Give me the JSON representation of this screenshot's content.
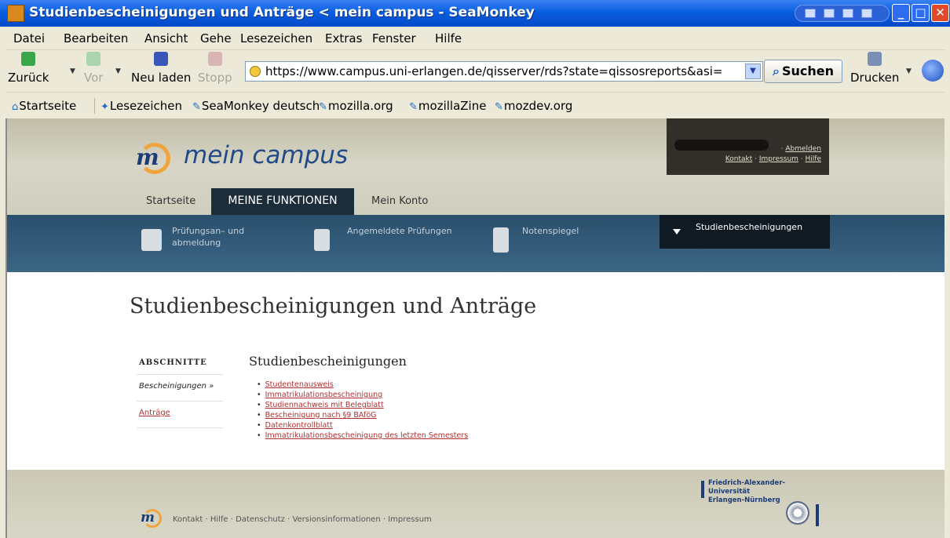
{
  "window": {
    "title": "Studienbescheinigungen und Anträge < mein campus - SeaMonkey"
  },
  "menu": [
    "Datei",
    "Bearbeiten",
    "Ansicht",
    "Gehe",
    "Lesezeichen",
    "Extras",
    "Fenster",
    "Hilfe"
  ],
  "toolbar": {
    "back": "Zurück",
    "forward": "Vor",
    "reload": "Neu laden",
    "stop": "Stopp",
    "url": "https://www.campus.uni-erlangen.de/qisserver/rds?state=qissosreports&asi=",
    "search": "Suchen",
    "print": "Drucken"
  },
  "bookmarks": [
    "Startseite",
    "Lesezeichen",
    "SeaMonkey deutsch",
    "mozilla.org",
    "mozillaZine",
    "mozdev.org"
  ],
  "site": {
    "logo_letter": "m",
    "logo_text": "mein campus",
    "user": {
      "logout": "Abmelden",
      "contact": "Kontakt",
      "imprint": "Impressum",
      "help": "Hilfe"
    },
    "nav": {
      "home": "Startseite",
      "functions": "MEINE FUNKTIONEN",
      "account": "Mein Konto"
    },
    "subnav": {
      "exams_line1": "Prüfungsan– und",
      "exams_line2": "abmeldung",
      "registered": "Angemeldete Prüfungen",
      "grades": "Notenspiegel",
      "certificates": "Studienbescheinigungen"
    },
    "page_title": "Studienbescheinigungen und Anträge",
    "sidebar": {
      "heading": "ABSCHNITTE",
      "current": "Bescheinigungen »",
      "link": "Anträge"
    },
    "section_title": "Studienbescheinigungen",
    "links": [
      "Studentenausweis",
      "Immatrikulationsbescheinigung",
      "Studiennachweis mit Belegblatt",
      "Bescheinigung nach §9 BAföG",
      "Datenkontrollblatt",
      "Immatrikulationsbescheinigung des letzten Semesters"
    ],
    "footer": {
      "contact": "Kontakt",
      "help": "Hilfe",
      "privacy": "Datenschutz",
      "versions": "Versionsinformationen",
      "imprint": "Impressum",
      "university_line1": "Friedrich-Alexander-Universität",
      "university_line2": "Erlangen-Nürnberg"
    }
  },
  "colors": {
    "titlebar": "#0a5fe0",
    "subnav": "#2f5877",
    "active_tab": "#1c2d3a",
    "link": "#b03030",
    "logo_orange": "#f2a43c"
  }
}
